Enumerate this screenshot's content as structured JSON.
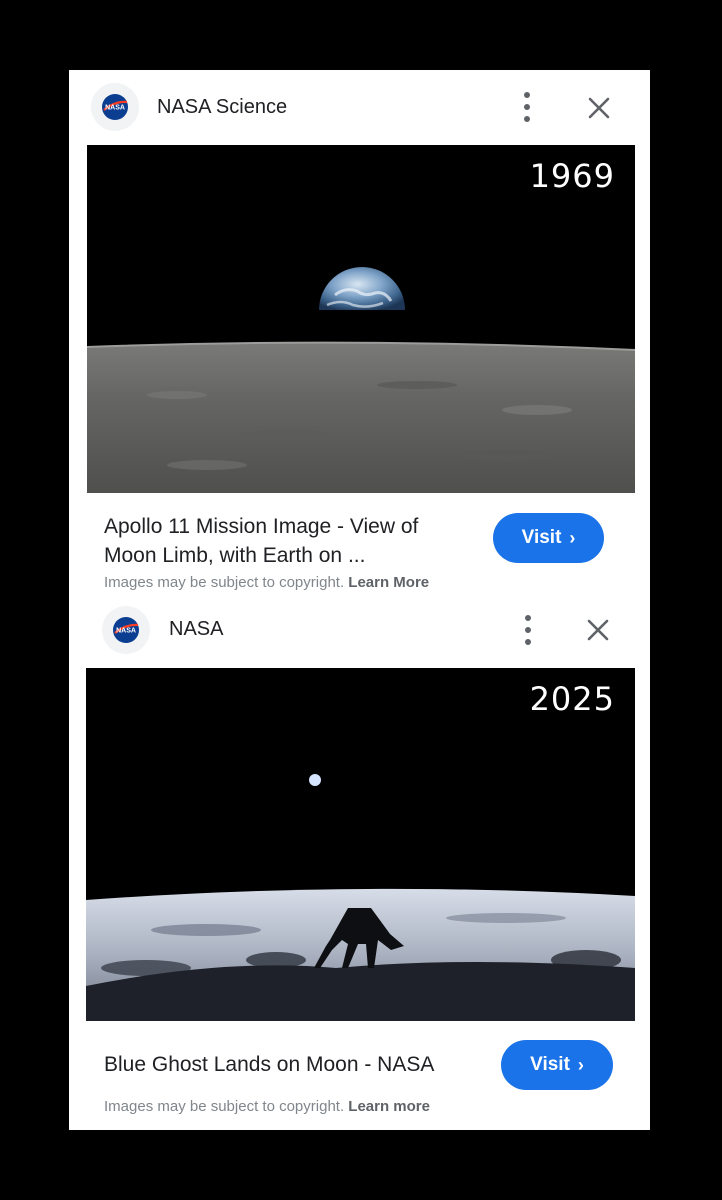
{
  "results": [
    {
      "source": "NASA Science",
      "year_overlay": "1969",
      "title": "Apollo 11 Mission Image - View of Moon Limb, with Earth on ...",
      "visit_label": "Visit",
      "copyright_text": "Images may be subject to copyright.",
      "learn_more": "Learn More"
    },
    {
      "source": "NASA",
      "year_overlay": "2025",
      "title": "Blue Ghost Lands on Moon - NASA",
      "visit_label": "Visit",
      "copyright_text": "Images may be subject to copyright.",
      "learn_more": "Learn more"
    }
  ],
  "logo_text": "NASA",
  "icons": {
    "logo": "nasa-meatball-icon",
    "menu": "more-vert-icon",
    "close": "close-icon",
    "visit": "chevron-right-icon"
  },
  "colors": {
    "accent": "#1a73e8",
    "background": "#000000",
    "card": "#ffffff"
  }
}
